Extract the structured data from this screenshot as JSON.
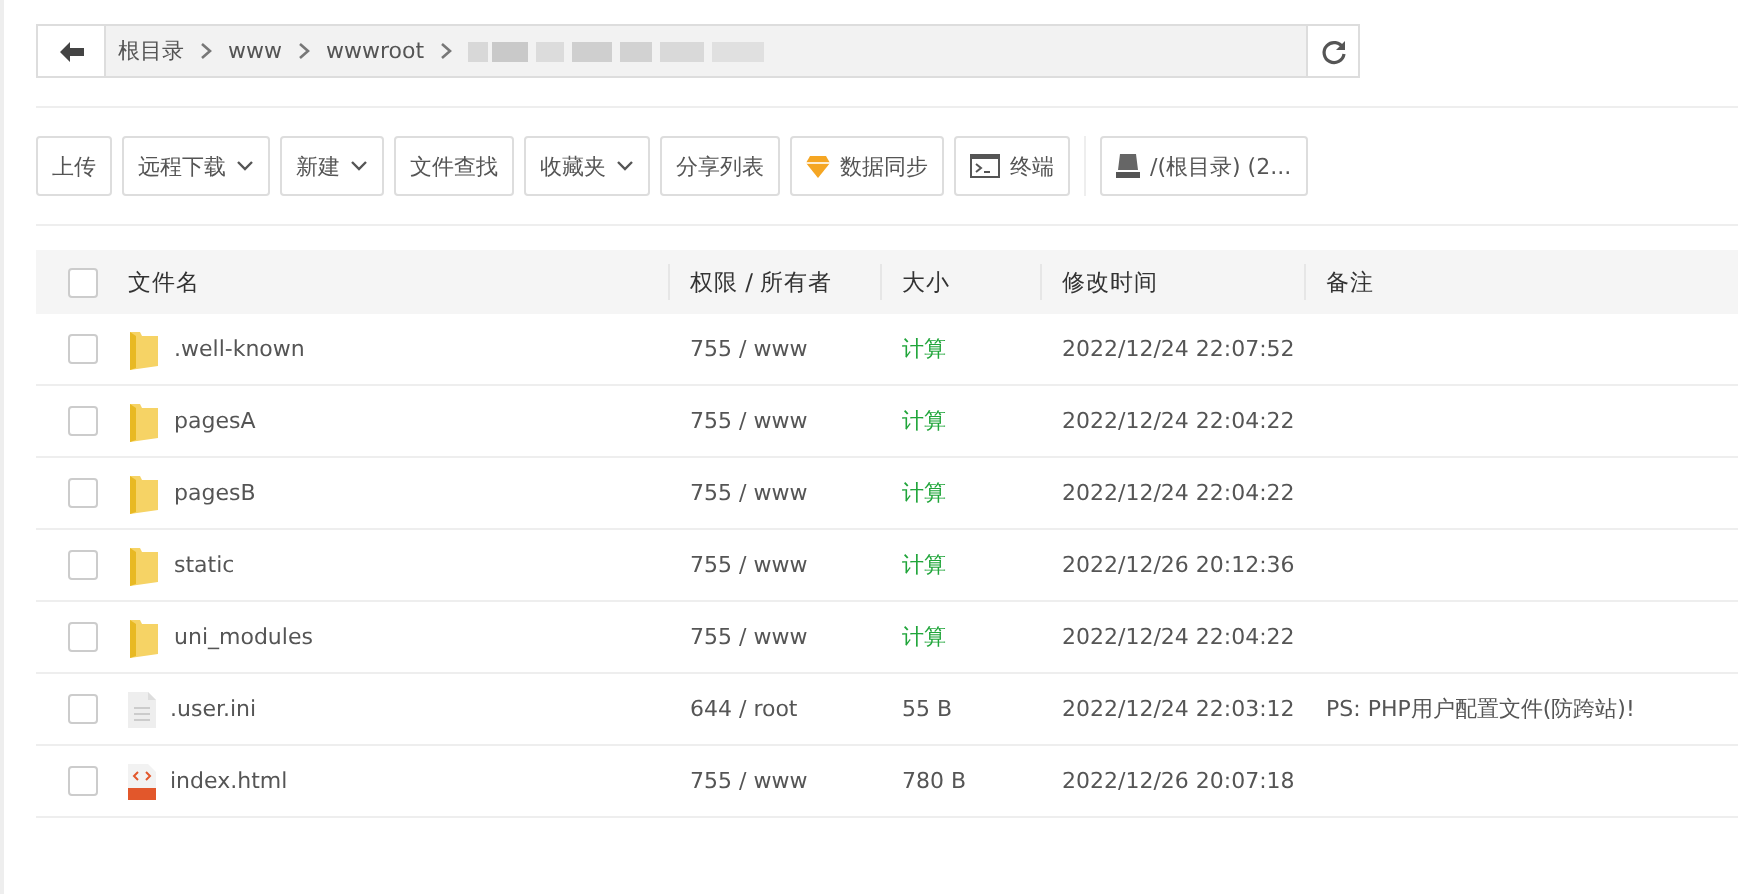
{
  "path_bar": {
    "segments": [
      "根目录",
      "www",
      "wwwroot"
    ]
  },
  "toolbar": [
    {
      "label": "上传",
      "kind": "plain"
    },
    {
      "label": "远程下载",
      "kind": "menu"
    },
    {
      "label": "新建",
      "kind": "menu"
    },
    {
      "label": "文件查找",
      "kind": "plain"
    },
    {
      "label": "收藏夹",
      "kind": "menu"
    },
    {
      "label": "分享列表",
      "kind": "plain"
    },
    {
      "label": "数据同步",
      "kind": "sync"
    },
    {
      "label": "终端",
      "kind": "terminal"
    },
    {
      "label": "/(根目录) (2...",
      "kind": "disk"
    }
  ],
  "table": {
    "columns": [
      "文件名",
      "权限 / 所有者",
      "大小",
      "修改时间",
      "备注"
    ],
    "all_checked": false,
    "rows": [
      {
        "kind": "folder",
        "checked": false,
        "name": ".well-known",
        "perm": "755 / www",
        "size": "计算",
        "time": "2022/12/24 22:07:52"
      },
      {
        "kind": "folder",
        "checked": false,
        "name": "pagesA",
        "perm": "755 / www",
        "size": "计算",
        "time": "2022/12/24 22:04:22"
      },
      {
        "kind": "folder",
        "checked": false,
        "name": "pagesB",
        "perm": "755 / www",
        "size": "计算",
        "time": "2022/12/24 22:04:22"
      },
      {
        "kind": "folder",
        "checked": false,
        "name": "static",
        "perm": "755 / www",
        "size": "计算",
        "time": "2022/12/26 20:12:36"
      },
      {
        "kind": "folder",
        "checked": false,
        "name": "uni_modules",
        "perm": "755 / www",
        "size": "计算",
        "time": "2022/12/24 22:04:22"
      },
      {
        "kind": "file",
        "checked": false,
        "name": ".user.ini",
        "perm": "644 / root",
        "size": "55 B",
        "time": "2022/12/24 22:03:12",
        "note": "PS: PHP用户配置文件(防跨站)!"
      },
      {
        "kind": "html",
        "checked": false,
        "name": "index.html",
        "perm": "755 / www",
        "size": "780 B",
        "time": "2022/12/26 20:07:18"
      }
    ]
  }
}
